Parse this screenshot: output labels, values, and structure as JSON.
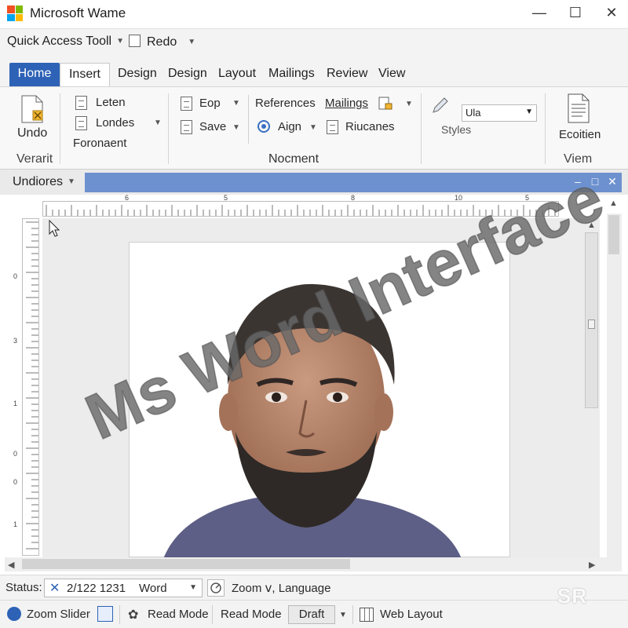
{
  "window": {
    "title": "Microsoft Wame",
    "logo_colors": [
      "#f25022",
      "#7fba00",
      "#00a4ef",
      "#ffb900"
    ]
  },
  "quick_access": {
    "label": "Quick Access Tooll",
    "redo_label": "Redo"
  },
  "tabs": [
    {
      "label": "Home",
      "active": true
    },
    {
      "label": "Insert"
    },
    {
      "label": "Design"
    },
    {
      "label": "Design"
    },
    {
      "label": "Layout"
    },
    {
      "label": "Mailings"
    },
    {
      "label": "Review"
    },
    {
      "label": "View"
    }
  ],
  "ribbon": {
    "undo_label": "Undo",
    "group1_label": "Verarit",
    "leten_label": "Leten",
    "londes_label": "Londes",
    "foronaent_label": "Foronaent",
    "eop_label": "Eop",
    "save_label": "Save",
    "references_label": "References",
    "mailings_label": "Mailings",
    "aign_label": "Aign",
    "riucanes_label": "Riucanes",
    "group2_label": "Nocment",
    "styles_label": "Styles",
    "style_value": "Ula",
    "ecoitien_label": "Ecoitien",
    "group3_label": "Viem"
  },
  "document": {
    "name": "Undiores"
  },
  "ruler": {
    "h_numbers": [
      "6",
      "5",
      "8",
      "10",
      "5"
    ],
    "v_numbers": [
      "0",
      "3",
      "1",
      "0",
      "0",
      "1"
    ]
  },
  "status": {
    "label": "Status:",
    "value": "2/122 1231",
    "combo_value": "Word",
    "zoom_text": "Zoom ⅴ, Language"
  },
  "bottom": {
    "zoom_slider": "Zoom Slider",
    "read_mode_1": "Read Mode",
    "read_mode_2": "Read Mode",
    "draft": "Draft",
    "web_layout": "Web Layout"
  },
  "watermark": {
    "text": "Ms Word Interface",
    "corner_logo": "SR"
  },
  "colors": {
    "accent": "#2d62b6",
    "doc_strip": "#6d91cf"
  }
}
